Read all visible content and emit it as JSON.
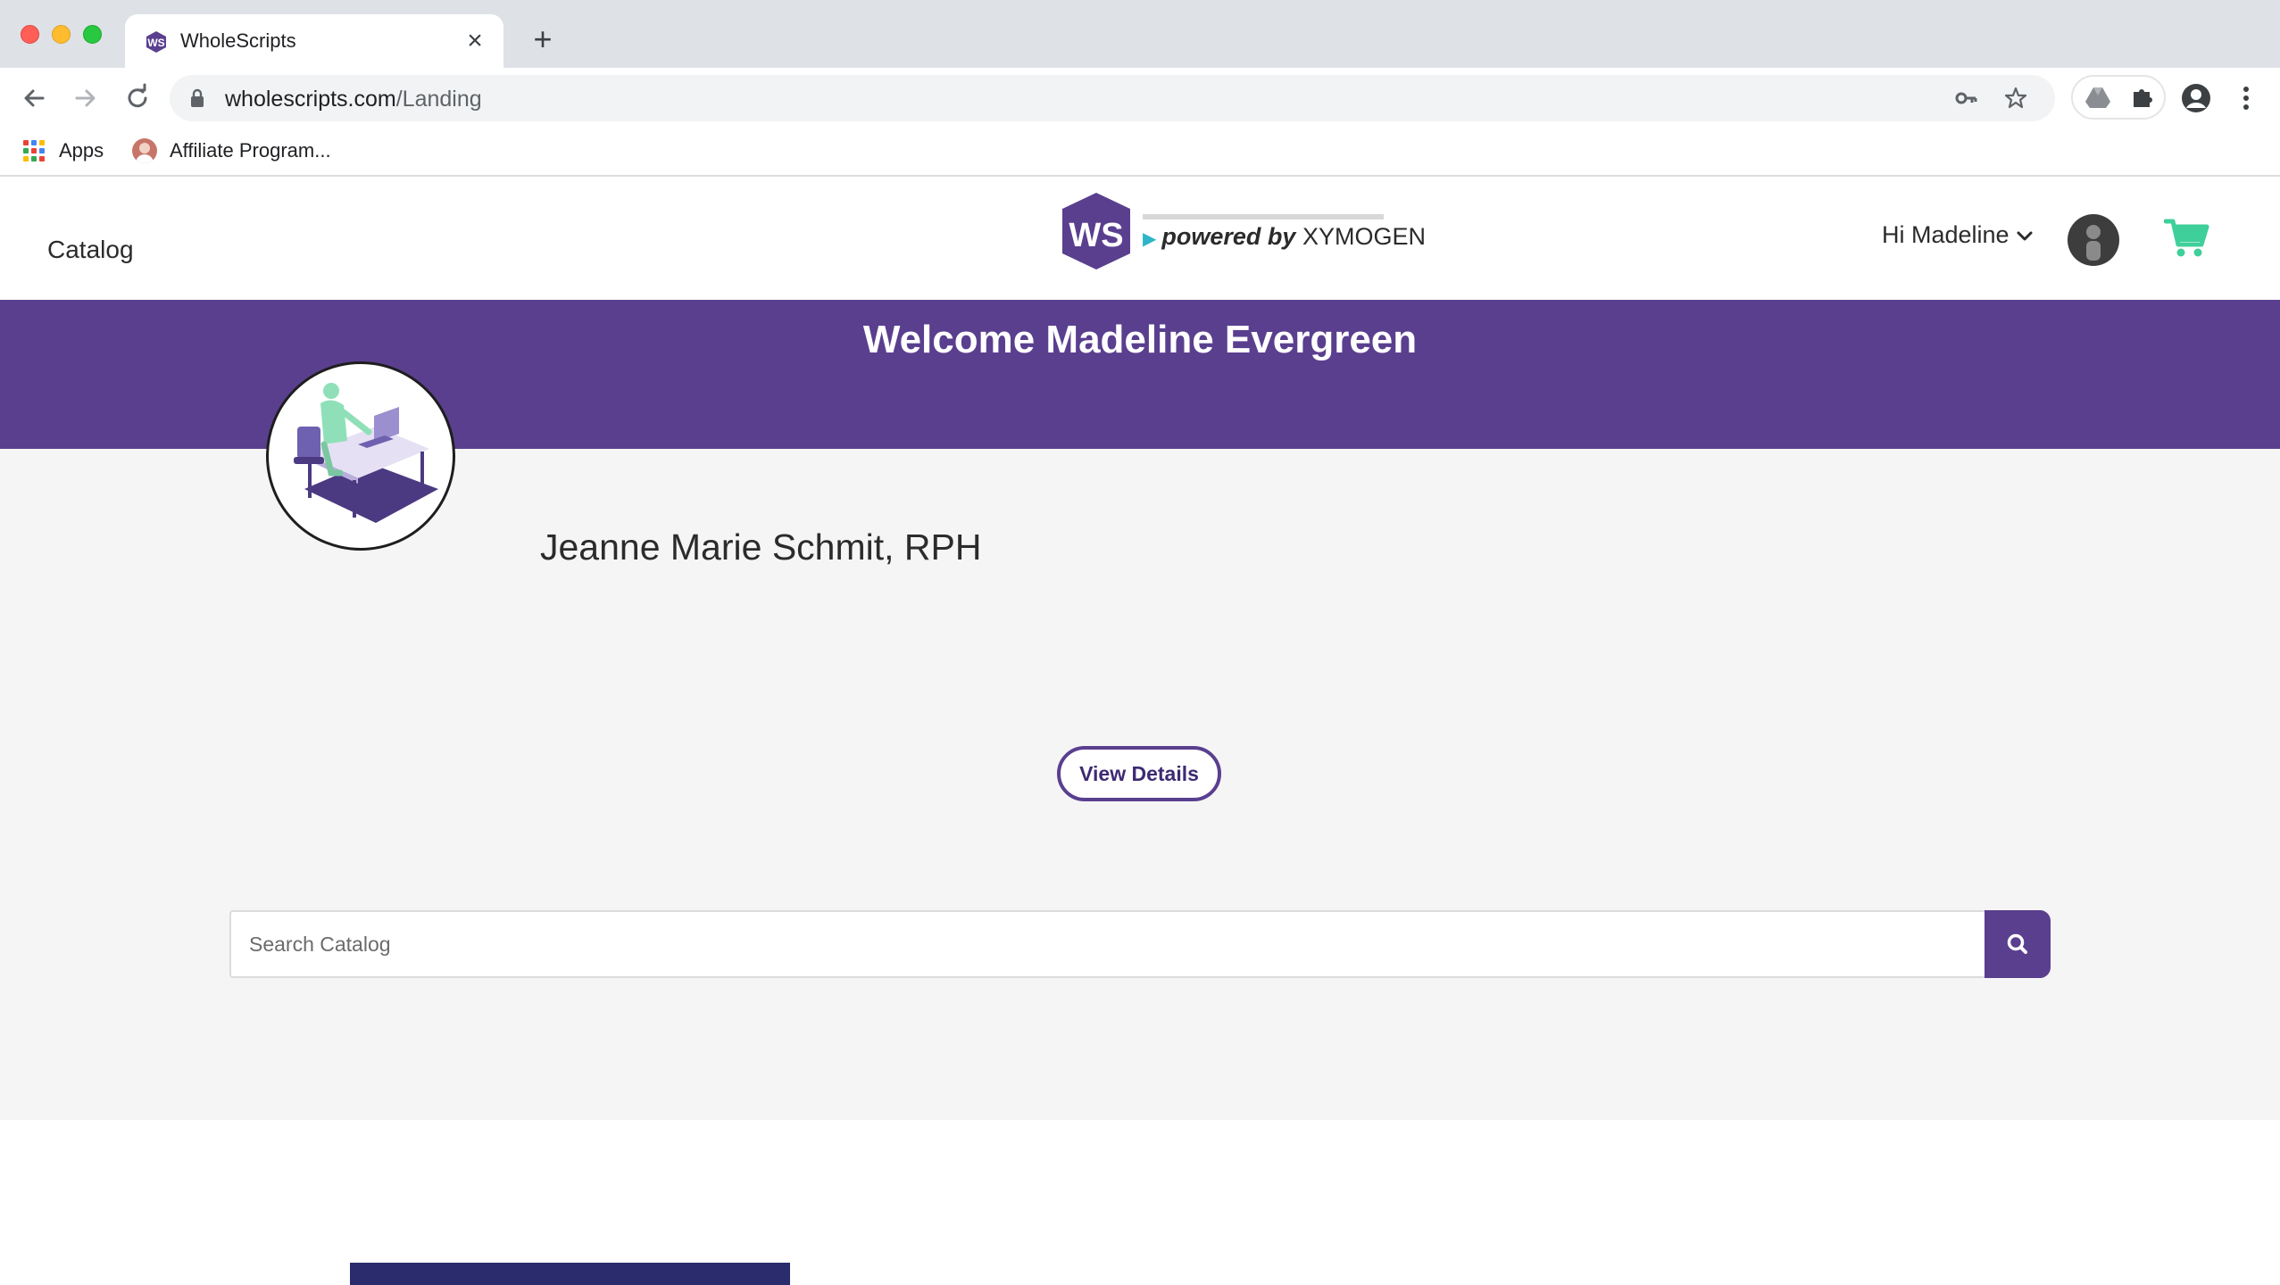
{
  "browser": {
    "tab_title": "WholeScripts",
    "url_host": "wholescripts.com",
    "url_path": "/Landing",
    "bookmarks": [
      {
        "label": "Apps"
      },
      {
        "label": "Affiliate Program..."
      }
    ]
  },
  "header": {
    "catalog_label": "Catalog",
    "logo_powered_by": "powered by",
    "logo_brand": "XYMOGEN",
    "greeting": "Hi Madeline",
    "accent_color": "#5a3f8f",
    "cart_color": "#3fcf9a"
  },
  "banner": {
    "title": "Welcome Madeline Evergreen"
  },
  "main": {
    "practitioner_name": "Jeanne Marie Schmit, RPH",
    "view_details_label": "View Details",
    "search_placeholder": "Search Catalog"
  }
}
